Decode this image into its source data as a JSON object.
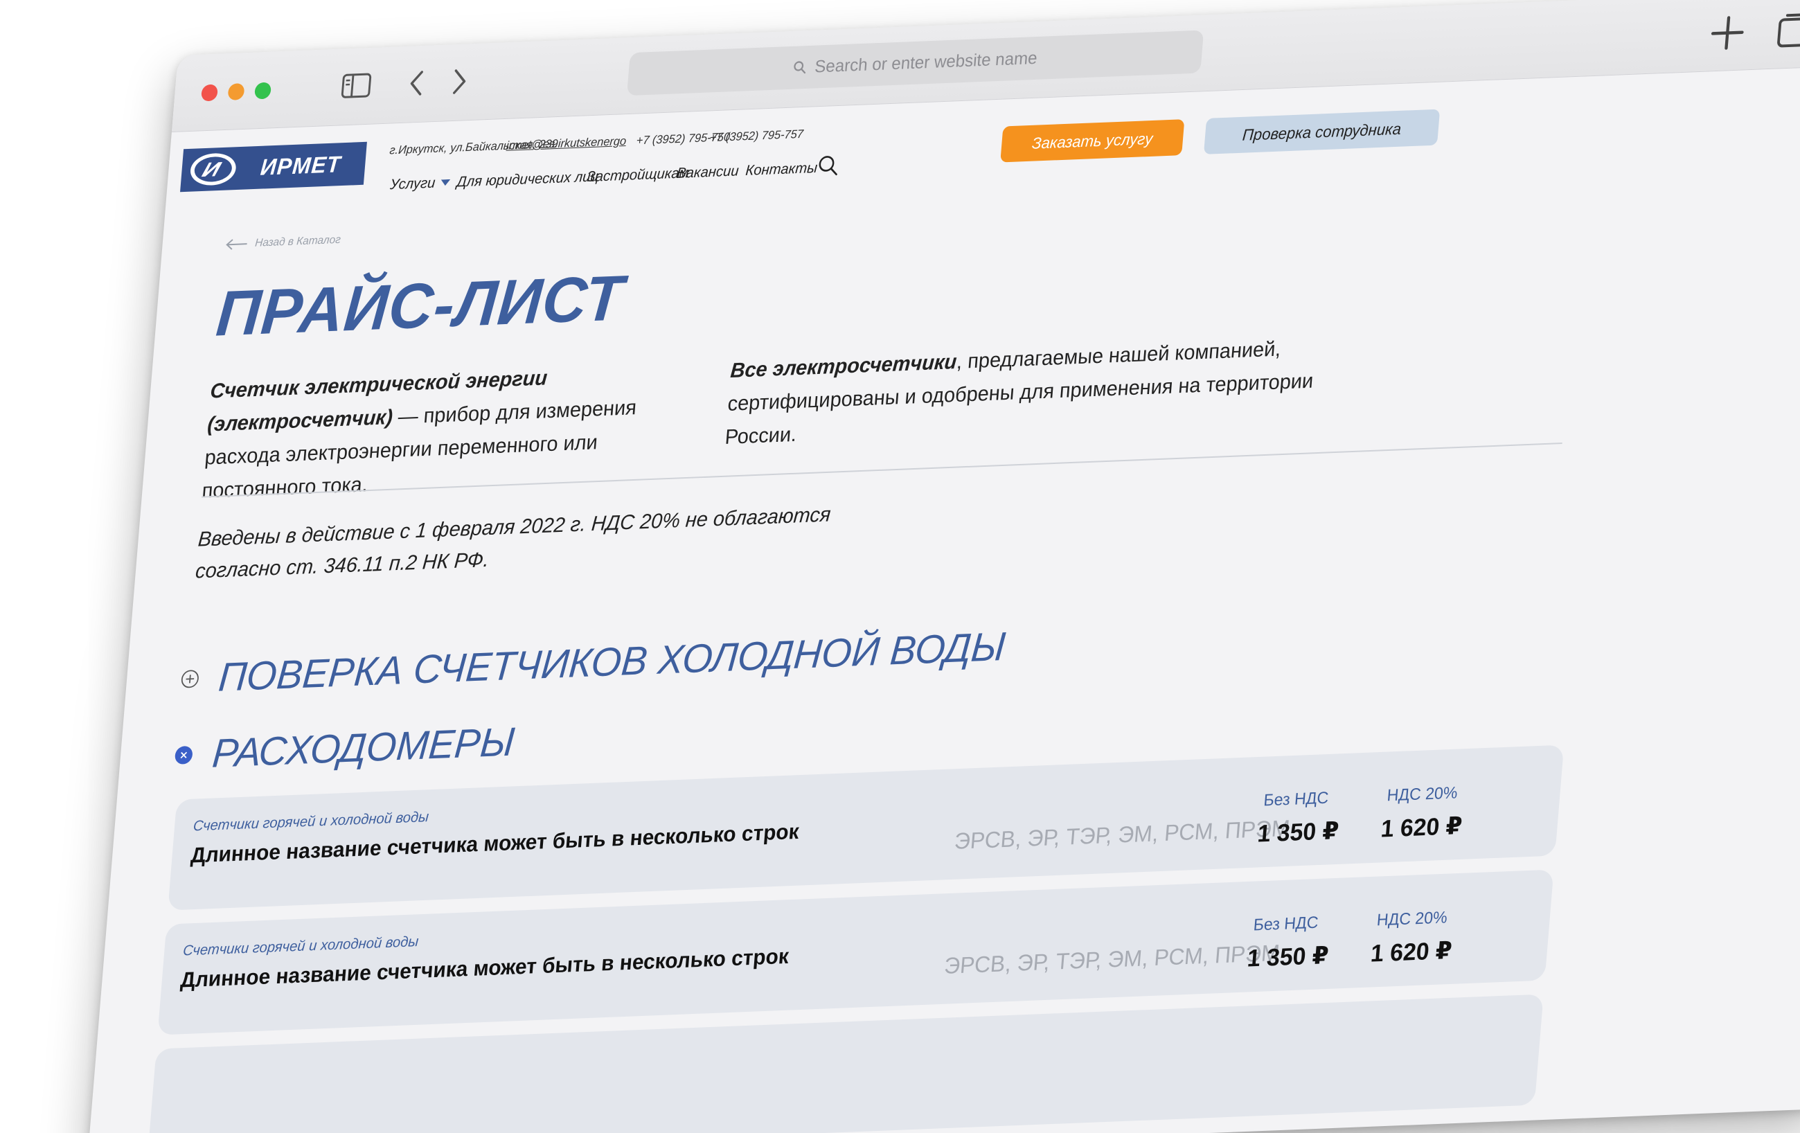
{
  "browser": {
    "search_placeholder": "Search or enter website name"
  },
  "site": {
    "logo_text": "ИРМЕТ",
    "address": "г.Иркутск, ул.Байкальская, 239",
    "email": "irmet@es.irkutskenergo",
    "phone_1": "+7 (3952) 795-750",
    "phone_2": "+7 (3952) 795-757",
    "nav": {
      "services": "Услуги",
      "legal": "Для юридических лиц",
      "builders": "Застройщикам",
      "vacancies": "Вакансии",
      "contacts": "Контакты"
    },
    "order_button": "Заказать услугу",
    "check_button": "Проверка сотрудника"
  },
  "page": {
    "back_link": "Назад в Каталог",
    "title": "ПРАЙС-ЛИСТ",
    "desc_left_bold": "Счетчик электрической энергии (электросчетчик)",
    "desc_left_rest": " — прибор для измерения расхода электроэнергии переменного или постоянного тока.",
    "desc_right_bold": "Все электросчетчики",
    "desc_right_rest": ", предлагаемые нашей компанией, сертифицированы и одобрены для применения на территории России.",
    "note": "Введены в действие с 1 февраля 2022 г. НДС 20% не облагаются согласно ст. 346.11 п.2 НК РФ."
  },
  "sections": [
    {
      "title": "ПОВЕРКА СЧЕТЧИКОВ ХОЛОДНОЙ ВОДЫ",
      "expanded": false
    },
    {
      "title": "РАСХОДОМЕРЫ",
      "expanded": true
    }
  ],
  "items": [
    {
      "category": "Счетчики горячей и холодной воды",
      "name": "Длинное название счетчика может быть в несколько строк",
      "codes": "ЭРСВ, ЭР, ТЭР, ЭМ, РСМ, ПРЭМ",
      "label_no_vat": "Без НДС",
      "price_no_vat": "1 350 ₽",
      "label_vat": "НДС 20%",
      "price_vat": "1 620 ₽"
    },
    {
      "category": "Счетчики горячей и холодной воды",
      "name": "Длинное название счетчика может быть в несколько строк",
      "codes": "ЭРСВ, ЭР, ТЭР, ЭМ, РСМ, ПРЭМ",
      "label_no_vat": "Без НДС",
      "price_no_vat": "1 350 ₽",
      "label_vat": "НДС 20%",
      "price_vat": "1 620 ₽"
    }
  ],
  "colors": {
    "brand_blue": "#3e5f9e",
    "logo_blue": "#34508e",
    "accent_orange": "#f5921e",
    "check_button_bg": "#c7d6e6",
    "expanded_marker": "#3a5fc8"
  }
}
